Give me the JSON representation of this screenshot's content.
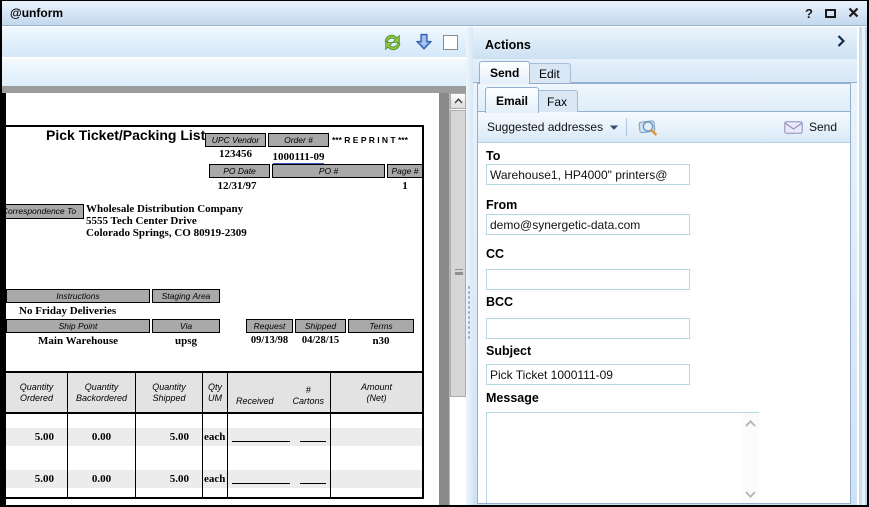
{
  "window": {
    "title": "@unform",
    "help_label": "?"
  },
  "doc": {
    "title": "Pick Ticket/Packing List",
    "reprint": "*** R E P R I N T ***",
    "hdr": {
      "upc_vendor_label": "UPC Vendor",
      "order_label": "Order #",
      "upc_vendor": "123456",
      "order": "1000111-09",
      "po_date_label": "PO Date",
      "po_label": "PO #",
      "page_label": "Page #",
      "po_date": "12/31/97",
      "po": "",
      "page": "1"
    },
    "correspondence": {
      "label": "Correspondence To",
      "line1": "Wholesale Distribution Company",
      "line2": "5555 Tech Center Drive",
      "line3": "Colorado Springs, CO 80919-2309"
    },
    "ship": {
      "instructions_label": "Instructions",
      "staging_label": "Staging Area",
      "instructions": "No Friday Deliveries",
      "ship_point_label": "Ship Point",
      "via_label": "Via",
      "ship_point": "Main Warehouse",
      "via": "upsg",
      "request_label": "Request",
      "shipped_label": "Shipped",
      "terms_label": "Terms",
      "request": "09/13/98",
      "shipped": "04/28/15",
      "terms": "n30"
    },
    "items": {
      "headers": {
        "ordered": "Quantity\nOrdered",
        "backordered": "Quantity\nBackordered",
        "shipped": "Quantity\nShipped",
        "qty_um": "Qty\nUM",
        "received": "Received",
        "cartons": "#\nCartons",
        "amount": "Amount\n(Net)"
      },
      "rows": [
        {
          "ordered": "5.00",
          "backordered": "0.00",
          "shipped": "5.00",
          "um": "each"
        },
        {
          "ordered": "5.00",
          "backordered": "0.00",
          "shipped": "5.00",
          "um": "each"
        }
      ]
    }
  },
  "actions": {
    "title": "Actions",
    "tabs": {
      "send": "Send",
      "edit": "Edit"
    },
    "subtabs": {
      "email": "Email",
      "fax": "Fax"
    },
    "toolbar": {
      "suggested": "Suggested addresses",
      "send": "Send"
    },
    "form": {
      "to_label": "To",
      "to": "Warehouse1, HP4000\" printers@",
      "from_label": "From",
      "from": "demo@synergetic-data.com",
      "cc_label": "CC",
      "cc": "",
      "bcc_label": "BCC",
      "bcc": "",
      "subject_label": "Subject",
      "subject": "Pick Ticket 1000111-09",
      "message_label": "Message",
      "message": ""
    }
  }
}
